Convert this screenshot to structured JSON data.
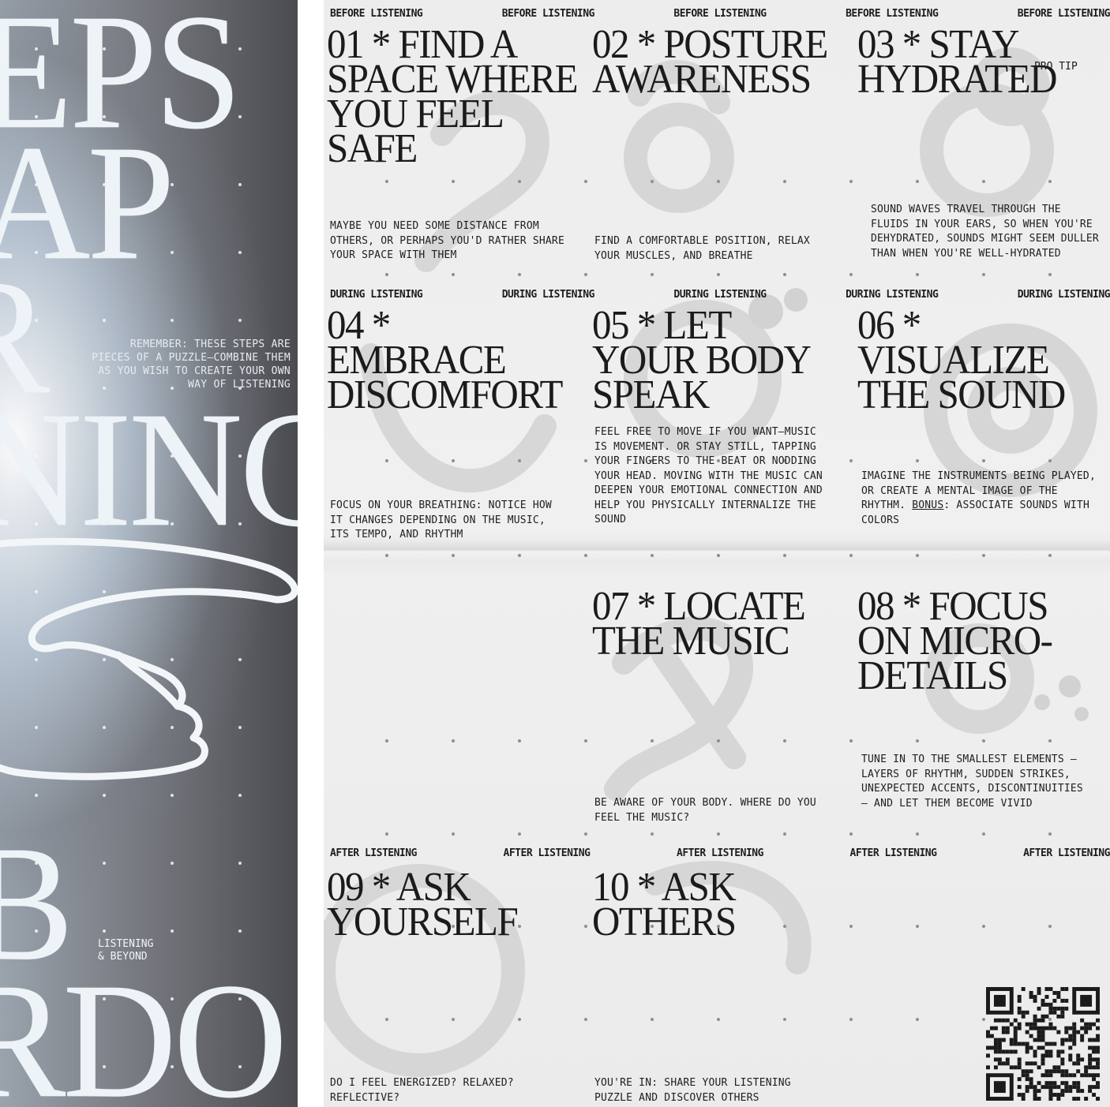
{
  "left_poster": {
    "headline_lines": [
      "EPS",
      "AP",
      "R",
      "NING",
      "B",
      "RDO"
    ],
    "note": "REMEMBER: THESE STEPS ARE PIECES OF A PUZZLE—COMBINE THEM AS YOU WISH TO CREATE YOUR OWN WAY OF LISTENING",
    "small_label_line1": "LISTENING",
    "small_label_line2": "& BEYOND"
  },
  "sections": {
    "before": "BEFORE LISTENING",
    "during": "DURING LISTENING",
    "after": "AFTER LISTENING"
  },
  "steps": [
    {
      "title": "01 * FIND A SPACE WHERE YOU FEEL SAFE",
      "body": "MAYBE YOU NEED SOME DISTANCE FROM OTHERS, OR PERHAPS YOU'D RATHER SHARE YOUR SPACE WITH THEM"
    },
    {
      "title": "02 * POSTURE AWARENESS",
      "body": "FIND A COMFORTABLE POSITION, RELAX YOUR MUSCLES, AND BREATHE"
    },
    {
      "title": "03 * STAY HYDRATED",
      "tag": "PRO TIP",
      "body": "SOUND WAVES TRAVEL THROUGH THE FLUIDS IN YOUR EARS, SO WHEN YOU'RE DEHYDRATED, SOUNDS MIGHT SEEM DULLER THAN WHEN YOU'RE WELL-HYDRATED"
    },
    {
      "title": "04 * EMBRACE DISCOMFORT",
      "body": "FOCUS ON YOUR BREATHING: NOTICE HOW IT CHANGES DEPENDING ON THE MUSIC, ITS TEMPO, AND RHYTHM"
    },
    {
      "title": "05 * LET YOUR BODY SPEAK",
      "body": "FEEL FREE TO MOVE IF YOU WANT—MUSIC IS MOVEMENT. OR STAY STILL, TAPPING YOUR FINGERS TO THE BEAT OR NODDING YOUR HEAD. MOVING WITH THE MUSIC CAN DEEPEN YOUR EMOTIONAL CONNECTION AND HELP YOU PHYSICALLY INTERNALIZE THE SOUND"
    },
    {
      "title": "06 * VISUALIZE THE SOUND",
      "body": "IMAGINE THE INSTRUMENTS BEING PLAYED, OR CREATE A MENTAL IMAGE OF THE RHYTHM.",
      "bonus_label": "BONUS",
      "bonus_text": ": ASSOCIATE SOUNDS WITH COLORS"
    },
    {
      "title": "07 * LOCATE THE MUSIC",
      "body": "BE AWARE OF YOUR BODY. WHERE DO YOU FEEL THE MUSIC?"
    },
    {
      "title": "08 * FOCUS ON MICRO-DETAILS",
      "body": "TUNE IN TO THE SMALLEST ELEMENTS — LAYERS OF RHYTHM, SUDDEN STRIKES, UNEXPECTED ACCENTS, DISCONTINUITIES — AND LET THEM BECOME VIVID"
    },
    {
      "title": "09 * ASK YOURSELF",
      "body": "DO I FEEL ENERGIZED? RELAXED? REFLECTIVE?"
    },
    {
      "title": "10 * ASK OTHERS",
      "body": "YOU'RE IN: SHARE YOUR LISTENING PUZZLE AND DISCOVER OTHERS"
    }
  ]
}
